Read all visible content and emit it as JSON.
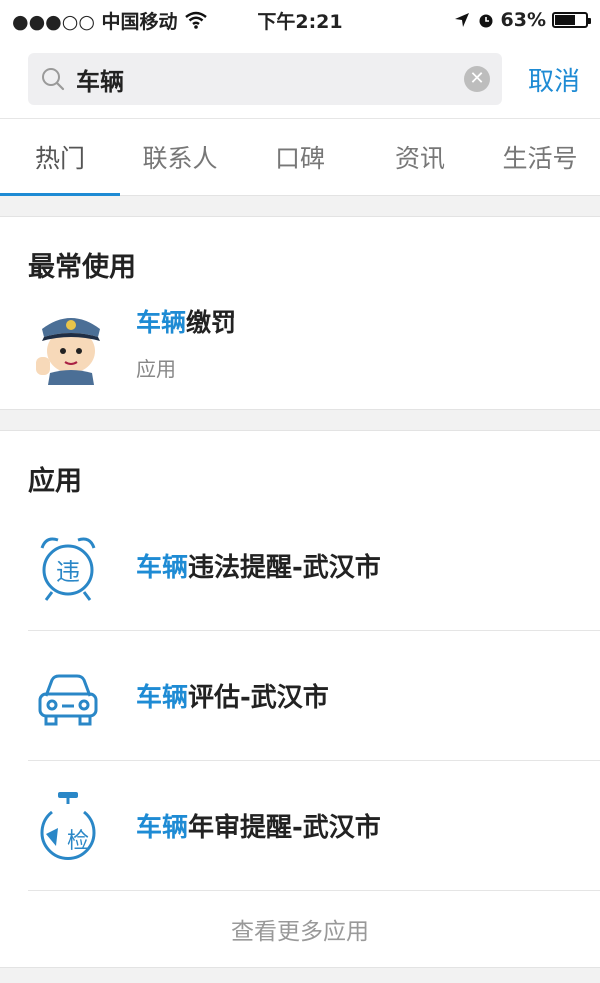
{
  "status_bar": {
    "carrier": "●●●○○ 中国移动",
    "time": "下午2:21",
    "battery": "63%",
    "battery_level": 0.63
  },
  "search": {
    "query": "车辆",
    "cancel_label": "取消",
    "icons": {
      "search": "search-icon",
      "clear": "clear-icon"
    }
  },
  "tabs": [
    {
      "label": "热门",
      "active": true
    },
    {
      "label": "联系人",
      "active": false
    },
    {
      "label": "口碑",
      "active": false
    },
    {
      "label": "资讯",
      "active": false
    },
    {
      "label": "生活号",
      "active": false
    }
  ],
  "frequent": {
    "title": "最常使用",
    "item": {
      "highlight": "车辆",
      "rest": "缴罚",
      "subtitle": "应用",
      "icon": "police-avatar-icon"
    }
  },
  "apps": {
    "title": "应用",
    "items": [
      {
        "highlight": "车辆",
        "rest": "违法提醒-武汉市",
        "icon": "violation-alarm-icon",
        "icon_text": "违"
      },
      {
        "highlight": "车辆",
        "rest": "评估-武汉市",
        "icon": "car-icon"
      },
      {
        "highlight": "车辆",
        "rest": "年审提醒-武汉市",
        "icon": "inspection-timer-icon",
        "icon_text": "检"
      }
    ],
    "more_label": "查看更多应用"
  },
  "colors": {
    "accent": "#1e8bd4",
    "background": "#f2f2f2"
  }
}
